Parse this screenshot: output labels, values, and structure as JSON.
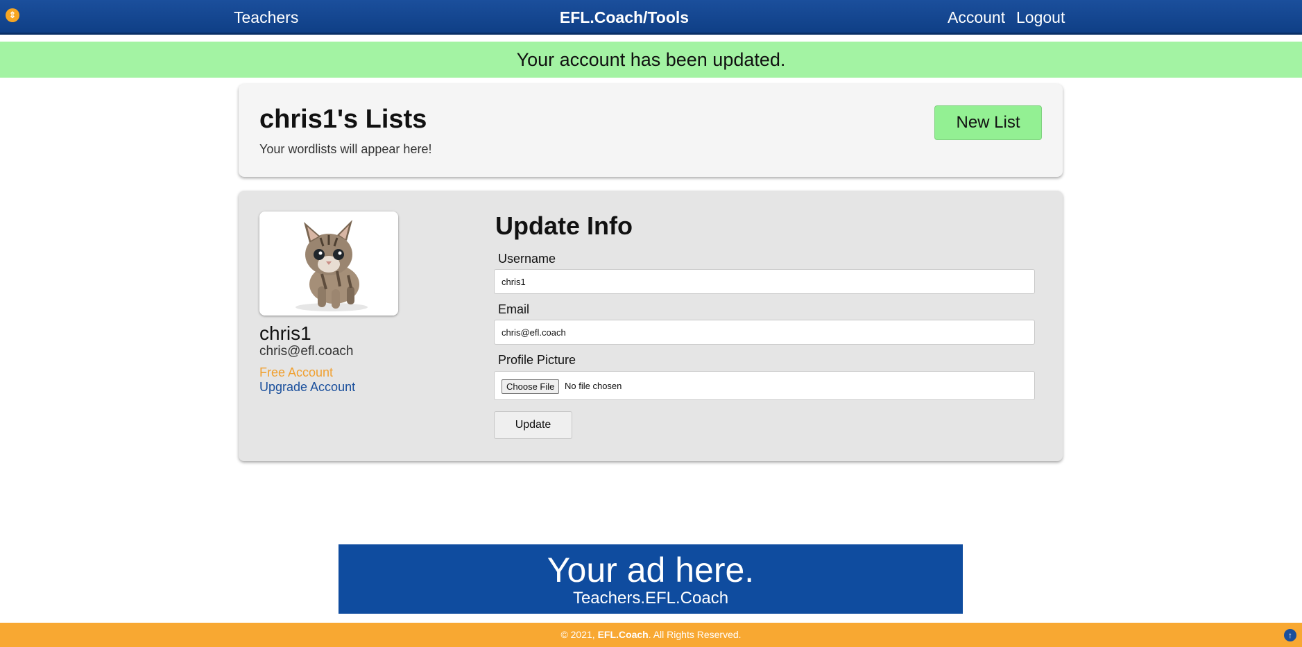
{
  "nav": {
    "left_link": "Teachers",
    "brand": "EFL.Coach/Tools",
    "account": "Account",
    "logout": "Logout"
  },
  "flash": {
    "message": "Your account has been updated."
  },
  "lists": {
    "title": "chris1's Lists",
    "subtitle": "Your wordlists will appear here!",
    "new_list_label": "New List"
  },
  "profile": {
    "name": "chris1",
    "email": "chris@efl.coach",
    "plan": "Free Account",
    "upgrade_label": "Upgrade Account"
  },
  "form": {
    "title": "Update Info",
    "username_label": "Username",
    "username_value": "chris1",
    "email_label": "Email",
    "email_value": "chris@efl.coach",
    "picture_label": "Profile Picture",
    "choose_file_label": "Choose File",
    "no_file_text": "No file chosen",
    "update_label": "Update"
  },
  "ad": {
    "headline": "Your ad here.",
    "site": "Teachers.EFL.Coach"
  },
  "footer": {
    "prefix": "© 2021, ",
    "brand": "EFL.Coach",
    "suffix": ". All Rights Reserved."
  },
  "colors": {
    "nav_bg": "#1b4f9c",
    "flash_bg": "#a3f3a3",
    "new_list_bg": "#93f093",
    "free_account": "#f0a030",
    "footer_bg": "#f8a832",
    "ad_bg": "#0f4c9f"
  },
  "icons": {
    "corner": "accessibility-icon",
    "back_to_top": "arrow-up-icon"
  }
}
